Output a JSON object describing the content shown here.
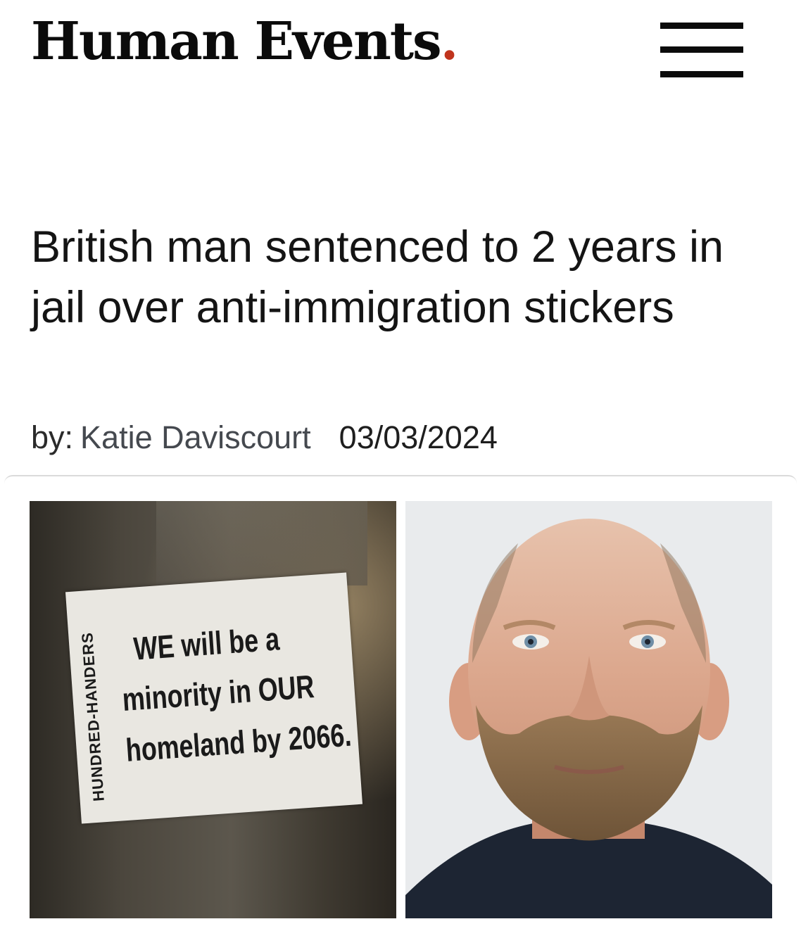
{
  "header": {
    "logo_text": "Human Events",
    "logo_dot": ".",
    "menu_icon": "hamburger-menu-icon"
  },
  "article": {
    "headline": "British man sentenced to 2 years in jail over anti-immigration stickers",
    "byline_prefix": "by:",
    "author": "Katie Daviscourt",
    "date": "03/03/2024"
  },
  "images": {
    "sticker": {
      "brand": "HUNDRED-HANDERS",
      "lines": [
        "WE will be a",
        "minority in OUR",
        "homeland by 2066."
      ]
    }
  },
  "colors": {
    "logo_dot": "#c0341d",
    "text": "#141414",
    "byline": "#3a3f47"
  }
}
